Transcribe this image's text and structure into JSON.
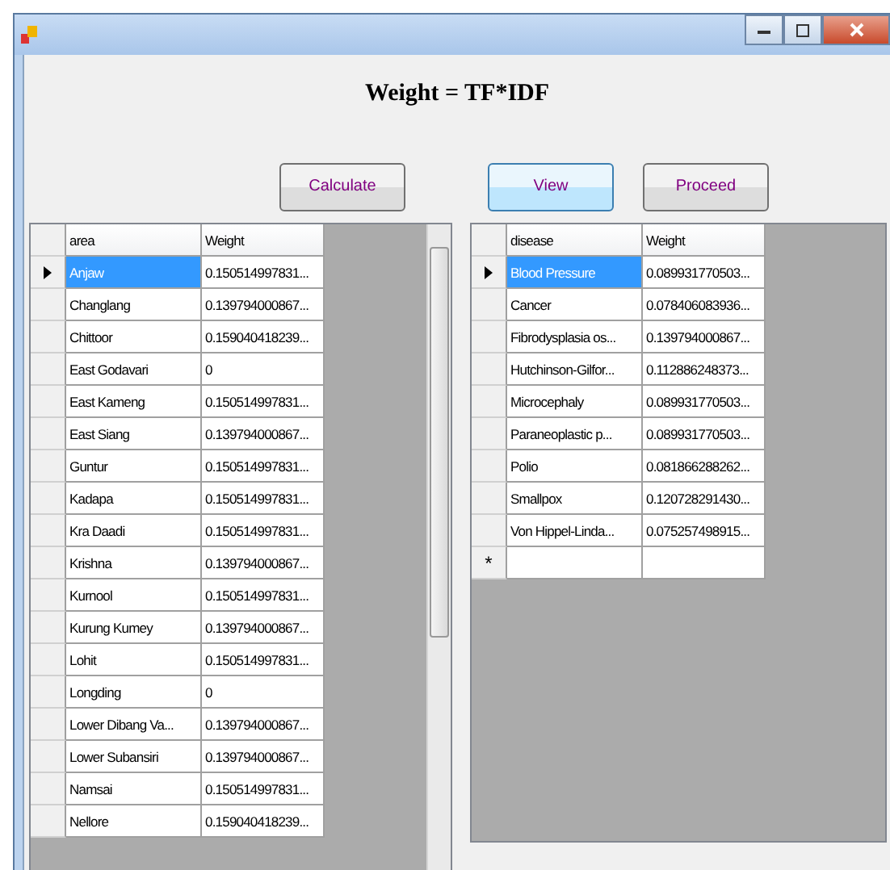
{
  "heading": "Weight = TF*IDF",
  "buttons": [
    {
      "label": "Calculate",
      "focused": false
    },
    {
      "label": "View",
      "focused": true
    },
    {
      "label": "Proceed",
      "focused": false
    }
  ],
  "grids": [
    {
      "columns": [
        "area",
        "Weight"
      ],
      "scrollbar": true,
      "rows": [
        {
          "cells": [
            "Anjaw",
            "0.150514997831..."
          ],
          "selected": true
        },
        {
          "cells": [
            "Changlang",
            "0.139794000867..."
          ],
          "selected": false
        },
        {
          "cells": [
            "Chittoor",
            "0.159040418239..."
          ],
          "selected": false
        },
        {
          "cells": [
            "East Godavari",
            "0"
          ],
          "selected": false
        },
        {
          "cells": [
            "East Kameng",
            "0.150514997831..."
          ],
          "selected": false
        },
        {
          "cells": [
            "East Siang",
            "0.139794000867..."
          ],
          "selected": false
        },
        {
          "cells": [
            "Guntur",
            "0.150514997831..."
          ],
          "selected": false
        },
        {
          "cells": [
            "Kadapa",
            "0.150514997831..."
          ],
          "selected": false
        },
        {
          "cells": [
            "Kra Daadi",
            "0.150514997831..."
          ],
          "selected": false
        },
        {
          "cells": [
            "Krishna",
            "0.139794000867..."
          ],
          "selected": false
        },
        {
          "cells": [
            "Kurnool",
            "0.150514997831..."
          ],
          "selected": false
        },
        {
          "cells": [
            "Kurung Kumey",
            "0.139794000867..."
          ],
          "selected": false
        },
        {
          "cells": [
            "Lohit",
            "0.150514997831..."
          ],
          "selected": false
        },
        {
          "cells": [
            "Longding",
            "0"
          ],
          "selected": false
        },
        {
          "cells": [
            "Lower Dibang Va...",
            "0.139794000867..."
          ],
          "selected": false
        },
        {
          "cells": [
            "Lower Subansiri",
            "0.139794000867..."
          ],
          "selected": false
        },
        {
          "cells": [
            "Namsai",
            "0.150514997831..."
          ],
          "selected": false
        },
        {
          "cells": [
            "Nellore",
            "0.159040418239..."
          ],
          "selected": false
        }
      ]
    },
    {
      "columns": [
        "disease",
        "Weight"
      ],
      "scrollbar": false,
      "new_row_marker": "*",
      "rows": [
        {
          "cells": [
            "Blood Pressure",
            "0.089931770503..."
          ],
          "selected": true
        },
        {
          "cells": [
            "Cancer",
            "0.078406083936..."
          ],
          "selected": false
        },
        {
          "cells": [
            "Fibrodysplasia os...",
            "0.139794000867..."
          ],
          "selected": false
        },
        {
          "cells": [
            "Hutchinson-Gilfor...",
            "0.112886248373..."
          ],
          "selected": false
        },
        {
          "cells": [
            "Microcephaly",
            "0.089931770503..."
          ],
          "selected": false
        },
        {
          "cells": [
            "Paraneoplastic p...",
            "0.089931770503..."
          ],
          "selected": false
        },
        {
          "cells": [
            "Polio",
            "0.081866288262..."
          ],
          "selected": false
        },
        {
          "cells": [
            "Smallpox",
            "0.120728291430..."
          ],
          "selected": false
        },
        {
          "cells": [
            "Von Hippel-Linda...",
            "0.075257498915..."
          ],
          "selected": false
        }
      ]
    }
  ]
}
